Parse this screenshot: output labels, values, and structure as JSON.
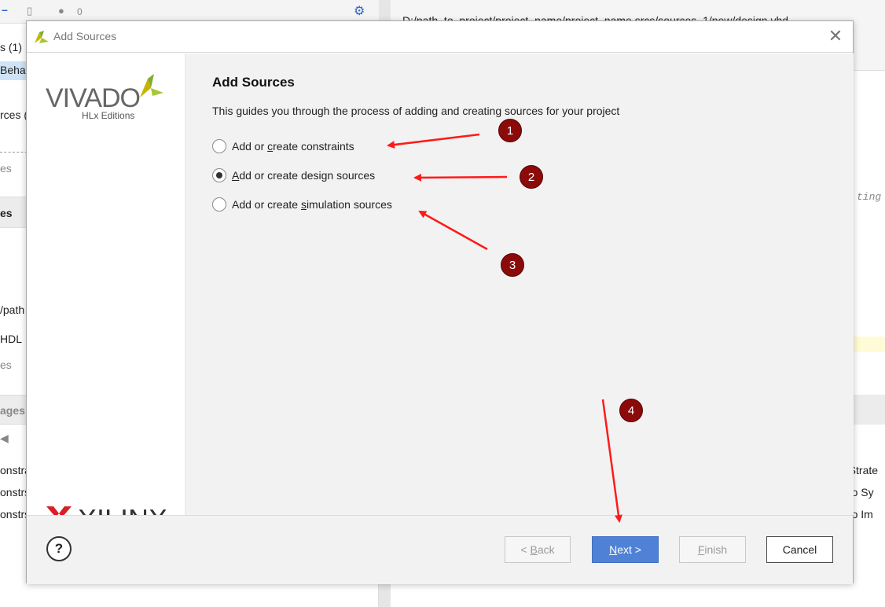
{
  "background": {
    "left_panel_texts": [
      "s (1)",
      "Behav",
      "rces (",
      "es",
      "es",
      "/path",
      "HDL",
      "es",
      "ages",
      "onstra",
      "onstrs",
      "onstrs"
    ],
    "toolbar_count": "0",
    "right_path": "D:/path_to_project/project_name/project_name.srcs/sources_1/new/design.vhd",
    "right_code_fragment": "ting",
    "right_table_texts": [
      "n Strate",
      "ado Sy",
      "ado Im"
    ]
  },
  "dialog": {
    "title": "Add Sources",
    "close_glyph": "✕",
    "logo": {
      "product": "VIVADO",
      "edition": "HLx Editions",
      "vendor": "XILINX"
    },
    "heading": "Add Sources",
    "description": "This guides you through the process of adding and creating sources for your project",
    "options": [
      {
        "pre": "Add or ",
        "key": "c",
        "post": "reate constraints",
        "selected": false
      },
      {
        "pre": "",
        "key": "A",
        "post": "dd or create design sources",
        "selected": true
      },
      {
        "pre": "Add or create ",
        "key": "s",
        "post": "imulation sources",
        "selected": false
      }
    ],
    "footer": {
      "help": "?",
      "back": {
        "pre": "< ",
        "key": "B",
        "post": "ack"
      },
      "next": {
        "pre": "",
        "key": "N",
        "post": "ext >"
      },
      "finish": {
        "pre": "",
        "key": "F",
        "post": "inish"
      },
      "cancel": "Cancel"
    }
  },
  "annotations": {
    "markers": [
      "1",
      "2",
      "3",
      "4"
    ],
    "color": "#ff0000",
    "marker_color": "#8b0b0b"
  }
}
